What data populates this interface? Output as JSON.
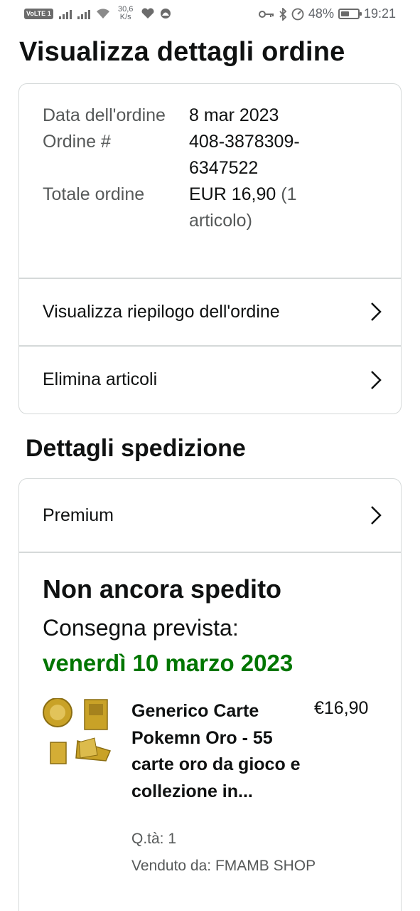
{
  "status_bar": {
    "volte": "VoLTE",
    "sim": "1",
    "net_speed": "30,6",
    "net_speed_unit": "K/s",
    "battery_percent": "48%",
    "battery_level": 0.48,
    "time": "19:21"
  },
  "page": {
    "title": "Visualizza dettagli ordine"
  },
  "order": {
    "rows": [
      {
        "label": "Data dell'ordine",
        "value": "8 mar 2023"
      },
      {
        "label": "Ordine #",
        "value": "408-3878309-6347522"
      },
      {
        "label": "Totale ordine",
        "value": "EUR 16,90",
        "value_note": "(1 articolo)"
      }
    ],
    "links": [
      {
        "label": "Visualizza riepilogo dell'ordine"
      },
      {
        "label": "Elimina articoli"
      }
    ]
  },
  "shipping": {
    "section_title": "Dettagli spedizione",
    "service": "Premium",
    "status": "Non ancora spedito",
    "eta_label": "Consegna prevista:",
    "eta_date": "venerdì 10 marzo 2023",
    "eta_color": "#007600",
    "item": {
      "title": "Generico Carte Pokemn Oro - 55 carte oro da gioco e collezione in...",
      "price": "€16,90",
      "qty": "Q.tà: 1",
      "seller": "Venduto da: FMAMB SHOP"
    }
  },
  "colors": {
    "text": "#0f1111",
    "muted": "#565959",
    "border": "#d5d9d9",
    "gold": "#c9a227"
  },
  "icons": [
    "key-icon",
    "bluetooth-icon",
    "speed-icon",
    "battery-icon",
    "wifi-icon",
    "chevron-right-icon"
  ]
}
